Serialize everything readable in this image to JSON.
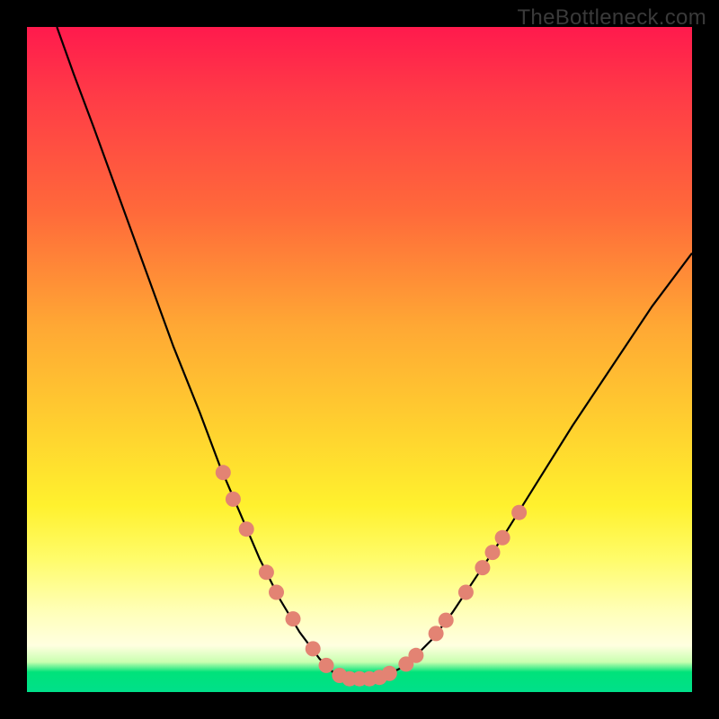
{
  "watermark": "TheBottleneck.com",
  "colors": {
    "frame": "#000000",
    "curve": "#000000",
    "dot_fill": "#e38373",
    "dot_stroke": "#c96a5d",
    "gradient_top": "#ff1a4d",
    "gradient_bottom": "#00e08a"
  },
  "chart_data": {
    "type": "line",
    "title": "",
    "xlabel": "",
    "ylabel": "",
    "xlim": [
      0,
      100
    ],
    "ylim": [
      0,
      100
    ],
    "curve": [
      {
        "x": 4.5,
        "y": 100
      },
      {
        "x": 7,
        "y": 93
      },
      {
        "x": 10,
        "y": 85
      },
      {
        "x": 14,
        "y": 74
      },
      {
        "x": 18,
        "y": 63
      },
      {
        "x": 22,
        "y": 52
      },
      {
        "x": 26,
        "y": 42
      },
      {
        "x": 29,
        "y": 34
      },
      {
        "x": 32,
        "y": 27
      },
      {
        "x": 35,
        "y": 20
      },
      {
        "x": 38,
        "y": 14
      },
      {
        "x": 41,
        "y": 9
      },
      {
        "x": 44,
        "y": 5
      },
      {
        "x": 46,
        "y": 3
      },
      {
        "x": 48,
        "y": 2
      },
      {
        "x": 50,
        "y": 2
      },
      {
        "x": 52,
        "y": 2
      },
      {
        "x": 54,
        "y": 2.5
      },
      {
        "x": 56,
        "y": 3.5
      },
      {
        "x": 58,
        "y": 5
      },
      {
        "x": 61,
        "y": 8
      },
      {
        "x": 64,
        "y": 12
      },
      {
        "x": 68,
        "y": 18
      },
      {
        "x": 72,
        "y": 24
      },
      {
        "x": 77,
        "y": 32
      },
      {
        "x": 82,
        "y": 40
      },
      {
        "x": 88,
        "y": 49
      },
      {
        "x": 94,
        "y": 58
      },
      {
        "x": 100,
        "y": 66
      }
    ],
    "dots": [
      {
        "x": 29.5,
        "y": 33
      },
      {
        "x": 31,
        "y": 29
      },
      {
        "x": 33,
        "y": 24.5
      },
      {
        "x": 36,
        "y": 18
      },
      {
        "x": 37.5,
        "y": 15
      },
      {
        "x": 40,
        "y": 11
      },
      {
        "x": 43,
        "y": 6.5
      },
      {
        "x": 45,
        "y": 4
      },
      {
        "x": 47,
        "y": 2.5
      },
      {
        "x": 48.5,
        "y": 2
      },
      {
        "x": 50,
        "y": 2
      },
      {
        "x": 51.5,
        "y": 2
      },
      {
        "x": 53,
        "y": 2.2
      },
      {
        "x": 54.5,
        "y": 2.8
      },
      {
        "x": 57,
        "y": 4.2
      },
      {
        "x": 58.5,
        "y": 5.5
      },
      {
        "x": 61.5,
        "y": 8.8
      },
      {
        "x": 63,
        "y": 10.8
      },
      {
        "x": 66,
        "y": 15
      },
      {
        "x": 68.5,
        "y": 18.7
      },
      {
        "x": 70,
        "y": 21
      },
      {
        "x": 71.5,
        "y": 23.2
      },
      {
        "x": 74,
        "y": 27
      }
    ]
  }
}
